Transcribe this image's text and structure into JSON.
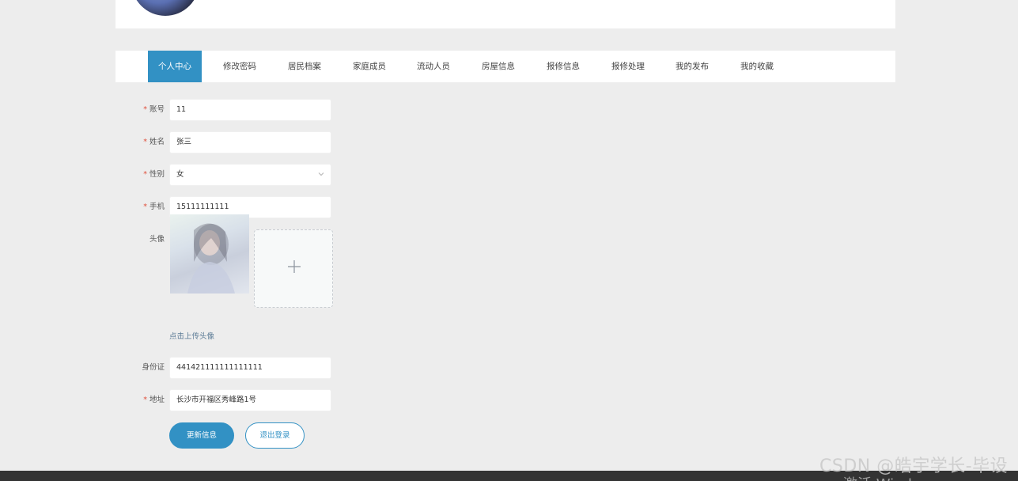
{
  "tabs": [
    {
      "label": "个人中心",
      "active": true
    },
    {
      "label": "修改密码"
    },
    {
      "label": "居民档案"
    },
    {
      "label": "家庭成员"
    },
    {
      "label": "流动人员"
    },
    {
      "label": "房屋信息"
    },
    {
      "label": "报修信息"
    },
    {
      "label": "报修处理"
    },
    {
      "label": "我的发布"
    },
    {
      "label": "我的收藏"
    }
  ],
  "form": {
    "account": {
      "label": "账号",
      "value": "11",
      "required": true
    },
    "name": {
      "label": "姓名",
      "value": "张三",
      "required": true
    },
    "gender": {
      "label": "性别",
      "value": "女",
      "required": true
    },
    "phone": {
      "label": "手机",
      "value": "15111111111",
      "required": true
    },
    "avatar": {
      "label": "头像",
      "upload_hint": "点击上传头像"
    },
    "id_card": {
      "label": "身份证",
      "value": "441421111111111111",
      "required": false
    },
    "address": {
      "label": "地址",
      "value": "长沙市开福区秀峰路1号",
      "required": true
    }
  },
  "buttons": {
    "update": "更新信息",
    "logout": "退出登录"
  },
  "required_mark": "*",
  "watermark": "CSDN @皓宇学长-毕设",
  "activate_windows": "激活 Windows",
  "colors": {
    "primary": "#3291c4",
    "required": "#e0503c",
    "background": "#ededed"
  }
}
